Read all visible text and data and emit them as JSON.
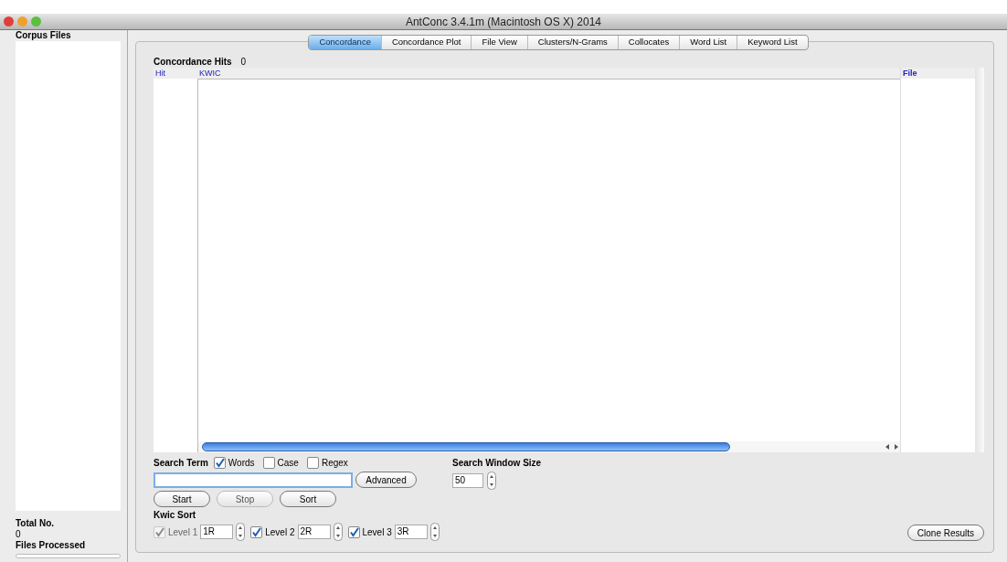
{
  "window": {
    "title": "AntConc 3.4.1m (Macintosh OS X) 2014"
  },
  "sidebar": {
    "title": "Corpus Files",
    "total_label": "Total No.",
    "total_value": "0",
    "processed_label": "Files Processed",
    "progress": {
      "level": 0
    }
  },
  "tabs": [
    {
      "label": "Concordance",
      "selected": true
    },
    {
      "label": "Concordance Plot",
      "selected": false
    },
    {
      "label": "File View",
      "selected": false
    },
    {
      "label": "Clusters/N-Grams",
      "selected": false
    },
    {
      "label": "Collocates",
      "selected": false
    },
    {
      "label": "Word List",
      "selected": false
    },
    {
      "label": "Keyword List",
      "selected": false
    }
  ],
  "hits": {
    "label": "Concordance Hits",
    "value": "0"
  },
  "table": {
    "columns": [
      "Hit",
      "KWIC",
      "File"
    ]
  },
  "search": {
    "label": "Search Term",
    "options": [
      {
        "label": "Words",
        "checked": true
      },
      {
        "label": "Case",
        "checked": false
      },
      {
        "label": "Regex",
        "checked": false
      }
    ],
    "advanced": "Advanced",
    "buttons": [
      {
        "label": "Start",
        "disabled": false
      },
      {
        "label": "Stop",
        "disabled": true
      },
      {
        "label": "Sort",
        "disabled": false
      }
    ]
  },
  "window_size": {
    "label": "Search Window Size",
    "value": "50"
  },
  "kwic_sort": {
    "label": "Kwic Sort",
    "levels": [
      {
        "label": "Level 1",
        "value": "1R",
        "checked": true,
        "disabled": true
      },
      {
        "label": "Level 2",
        "value": "2R",
        "checked": true,
        "disabled": false
      },
      {
        "label": "Level 3",
        "value": "3R",
        "checked": true,
        "disabled": false
      }
    ]
  },
  "clone_button": "Clone Results"
}
